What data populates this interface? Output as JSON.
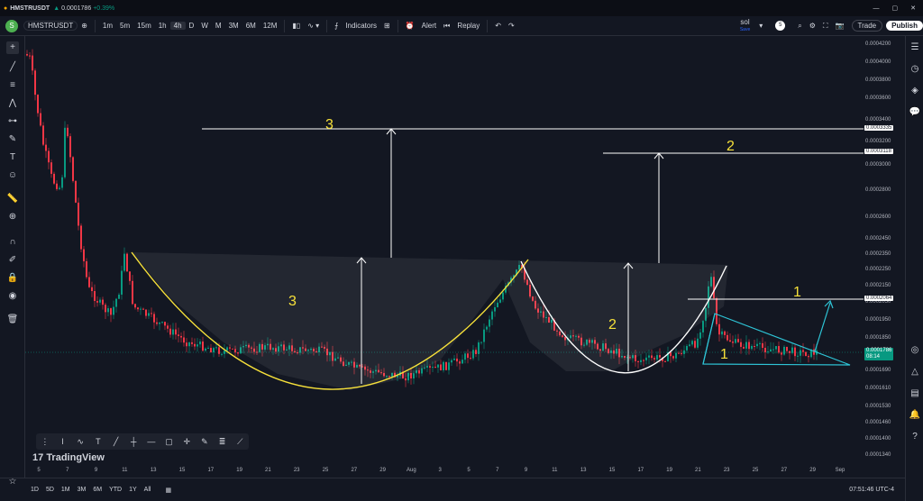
{
  "header": {
    "symbol": "HMSTRUSDT",
    "price": "0.0001786",
    "change": "+0.39%",
    "user": "sol",
    "user_sub": "Save",
    "notif": "5"
  },
  "toolbar": {
    "symbol_button": "HMSTRUSDT",
    "timeframes": [
      "1m",
      "5m",
      "15m",
      "1h",
      "4h",
      "D",
      "W",
      "M",
      "3M",
      "6M",
      "12M"
    ],
    "active_tf": "4h",
    "indicators": "Indicators",
    "alert": "Alert",
    "replay": "Replay",
    "trade": "Trade",
    "publish": "Publish"
  },
  "price_axis": {
    "ticks": [
      "0.0004200",
      "0.0004000",
      "0.0003800",
      "0.0003600",
      "0.0003400",
      "0.0003200",
      "0.0003000",
      "0.0002800",
      "0.0002600",
      "0.0002450",
      "0.0002350",
      "0.0002250",
      "0.0002150",
      "0.0002050",
      "0.0001950",
      "0.0001850",
      "0.0001690",
      "0.0001610",
      "0.0001530",
      "0.0001460",
      "0.0001400",
      "0.0001340"
    ],
    "tag_1": "0.0003335",
    "tag_2": "0.0003118",
    "tag_3": "0.0002064",
    "current_price": "0.0001786",
    "current_timer": "08:14"
  },
  "time_axis": {
    "ticks": [
      "5",
      "7",
      "9",
      "11",
      "13",
      "15",
      "17",
      "19",
      "21",
      "23",
      "25",
      "27",
      "29",
      "Aug",
      "3",
      "5",
      "7",
      "9",
      "11",
      "13",
      "15",
      "17",
      "19",
      "21",
      "23",
      "25",
      "27",
      "29",
      "Sep"
    ]
  },
  "annotations": {
    "label_3_top": "3",
    "label_3_mid": "3",
    "label_2_top": "2",
    "label_2_mid": "2",
    "label_1_top": "1",
    "label_1_mid": "1"
  },
  "bottom": {
    "ranges": [
      "1D",
      "5D",
      "1M",
      "3M",
      "6M",
      "YTD",
      "1Y",
      "All"
    ],
    "clock": "07:51:46 UTC-4"
  },
  "watermark": "TradingView",
  "colors": {
    "background": "#131722",
    "yellow_curve": "#f7e13a",
    "white_curve": "#ffffff",
    "cyan_triangle": "#2ec4d6",
    "up_candle": "#089981",
    "down_candle": "#f23645"
  }
}
